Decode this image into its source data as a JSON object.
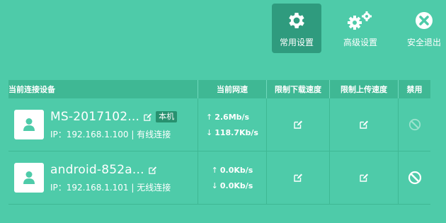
{
  "toolbar": {
    "common_label": "常用设置",
    "advanced_label": "高级设置",
    "logout_label": "安全退出"
  },
  "table": {
    "headers": [
      "当前连接设备",
      "当前网速",
      "限制下载速度",
      "限制上传速度",
      "禁用"
    ],
    "devices": [
      {
        "name": "MS-2017102...",
        "tag": "本机",
        "ip_line": "IP：192.168.1.100 | 有线连接",
        "up_arrow": "↑",
        "up_speed": "2.6Mb/s",
        "down_arrow": "↓",
        "down_speed": "118.7Kb/s",
        "ban_enabled": false
      },
      {
        "name": "android-852a...",
        "ip_line": "IP：192.168.1.101 | 无线连接",
        "up_arrow": "↑",
        "up_speed": "0.0Kb/s",
        "down_arrow": "↓",
        "down_speed": "0.0Kb/s",
        "ban_enabled": true
      }
    ]
  },
  "colors": {
    "background": "#4ecba9",
    "header": "#3fb894",
    "active_button": "#2f9b7e",
    "avatar_icon": "#4ecba9",
    "tag_bg": "#27916f"
  },
  "icons": {
    "common": "gear-icon",
    "advanced": "gears-icon",
    "logout": "close-circle-icon",
    "avatar": "user-icon",
    "edit": "edit-icon",
    "ban": "ban-icon"
  }
}
